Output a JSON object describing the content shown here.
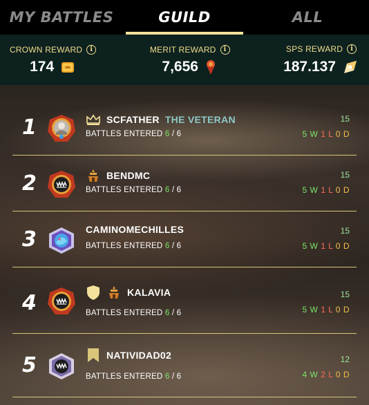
{
  "tabs": [
    {
      "label": "MY BATTLES",
      "active": false
    },
    {
      "label": "GUILD",
      "active": true
    },
    {
      "label": "ALL",
      "active": false
    }
  ],
  "rewards": [
    {
      "label": "CROWN REWARD",
      "value": "174",
      "icon": "crown-chest-icon"
    },
    {
      "label": "MERIT REWARD",
      "value": "7,656",
      "icon": "merit-icon"
    },
    {
      "label": "SPS REWARD",
      "value": "187.137",
      "icon": "sps-icon"
    }
  ],
  "battles_label": "BATTLES ENTERED",
  "rows": [
    {
      "rank": "1",
      "name": "SCFATHER",
      "title": "THE VETERAN",
      "entered": "6",
      "total": "6",
      "score": "15",
      "w": "5",
      "l": "1",
      "d": "0",
      "wl": "W",
      "ll": "L",
      "dl": "D",
      "sep": "/"
    },
    {
      "rank": "2",
      "name": "BENDMC",
      "title": "",
      "entered": "6",
      "total": "6",
      "score": "15",
      "w": "5",
      "l": "1",
      "d": "0",
      "wl": "W",
      "ll": "L",
      "dl": "D",
      "sep": "/"
    },
    {
      "rank": "3",
      "name": "CAMINOMECHILLES",
      "title": "",
      "entered": "6",
      "total": "6",
      "score": "15",
      "w": "5",
      "l": "1",
      "d": "0",
      "wl": "W",
      "ll": "L",
      "dl": "D",
      "sep": "/"
    },
    {
      "rank": "4",
      "name": "KALAVIA",
      "title": "",
      "entered": "6",
      "total": "6",
      "score": "15",
      "w": "5",
      "l": "1",
      "d": "0",
      "wl": "W",
      "ll": "L",
      "dl": "D",
      "sep": "/"
    },
    {
      "rank": "5",
      "name": "NATIVIDAD02",
      "title": "",
      "entered": "6",
      "total": "6",
      "score": "12",
      "w": "4",
      "l": "2",
      "d": "0",
      "wl": "W",
      "ll": "L",
      "dl": "D",
      "sep": "/"
    }
  ],
  "colors": {
    "accent": "#f3e29b",
    "reward_bar": "#0d211f",
    "win": "#7ce36a",
    "loss": "#ff6b5a",
    "draw": "#f3c04b",
    "title": "#8fc7c7"
  }
}
